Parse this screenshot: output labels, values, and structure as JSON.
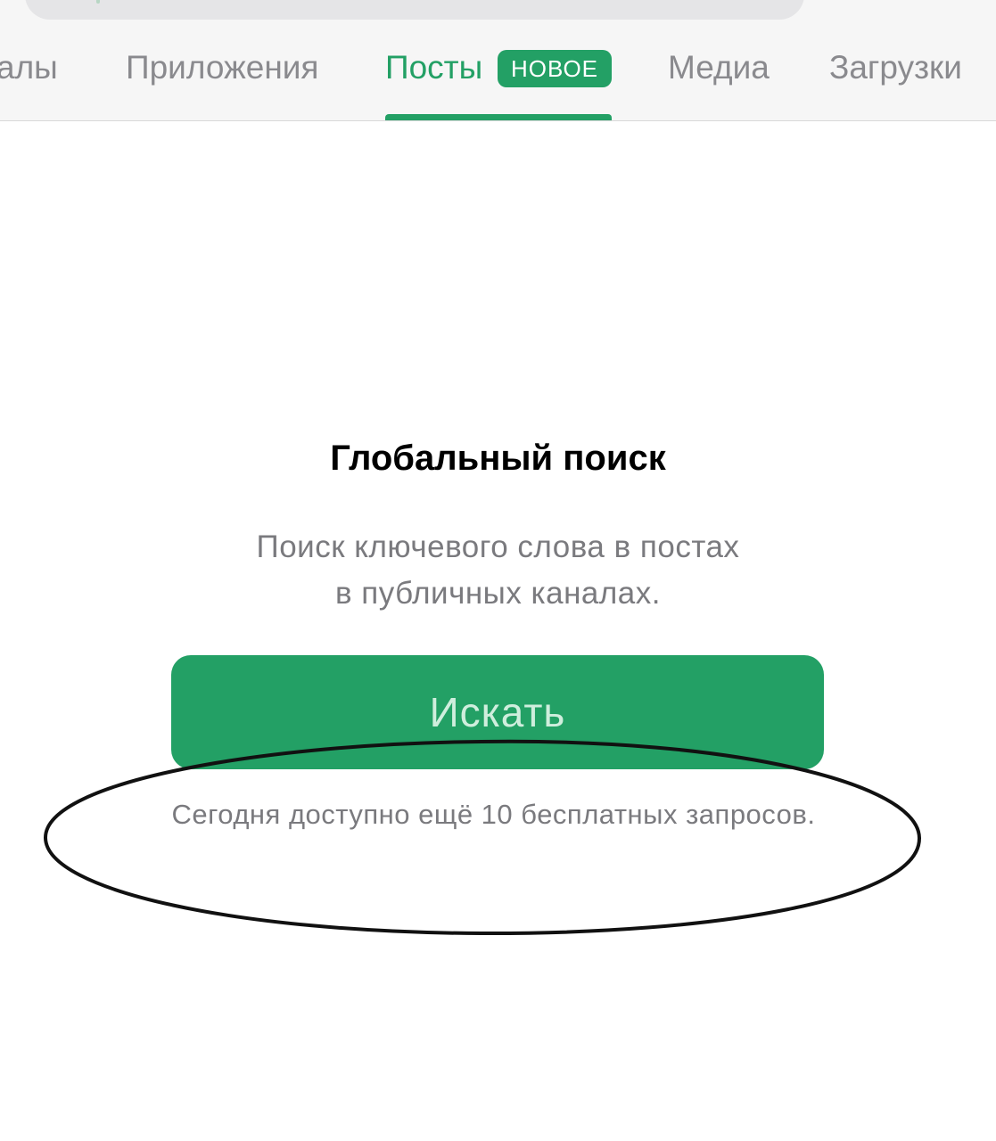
{
  "search": {
    "field": ""
  },
  "tabs": [
    {
      "label": "алы"
    },
    {
      "label": "Приложения"
    },
    {
      "label": "Посты",
      "badge": "НОВОЕ",
      "active": true
    },
    {
      "label": "Медиа"
    },
    {
      "label": "Загрузки"
    }
  ],
  "colors": {
    "accent": "#23a065",
    "inactive_tab": "#8a8a8e",
    "secondary_text": "#7a7a7e"
  },
  "empty_state": {
    "title": "Глобальный поиск",
    "description_line1": "Поиск ключевого слова в постах",
    "description_line2": "в публичных каналах.",
    "button_label": "Искать",
    "quota_text": "Сегодня доступно ещё 10 бесплатных запросов."
  }
}
